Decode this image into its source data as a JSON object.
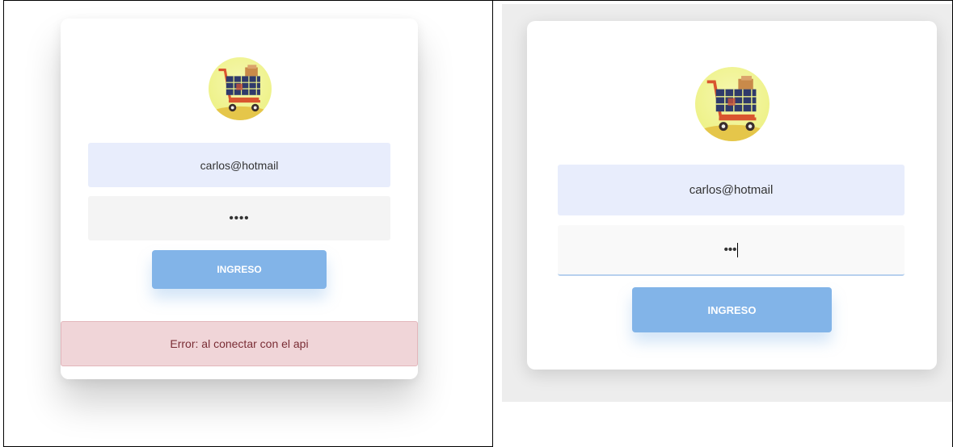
{
  "panels": [
    {
      "email_value": "carlos@hotmail",
      "password_mask": "••••",
      "button_label": "INGRESO",
      "error_message": "Error: al conectar con el api"
    },
    {
      "email_value": "carlos@hotmail",
      "password_mask": "•••",
      "button_label": "INGRESO"
    }
  ],
  "logo_icon": "shopping-cart-icon",
  "colors": {
    "accent": "#82b4e8",
    "email_bg": "#e8edfc",
    "error_bg": "#f0d5d8",
    "error_text": "#7a2d35"
  }
}
